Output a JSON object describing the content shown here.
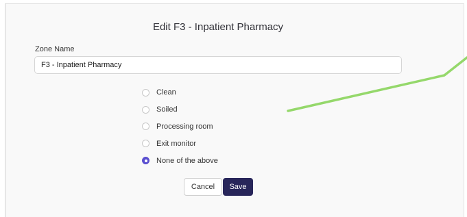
{
  "dialog": {
    "title": "Edit F3 - Inpatient Pharmacy"
  },
  "form": {
    "zone_name_label": "Zone Name",
    "zone_name_value": "F3 - Inpatient Pharmacy"
  },
  "zone_type_options": [
    {
      "label": "Clean",
      "selected": false
    },
    {
      "label": "Soiled",
      "selected": false
    },
    {
      "label": "Processing room",
      "selected": false
    },
    {
      "label": "Exit monitor",
      "selected": false
    },
    {
      "label": "None of the above",
      "selected": true
    }
  ],
  "actions": {
    "cancel_label": "Cancel",
    "save_label": "Save"
  },
  "colors": {
    "accent": "#5a4fd0",
    "primary_button": "#28265a",
    "annotation_line": "#95d86b"
  }
}
